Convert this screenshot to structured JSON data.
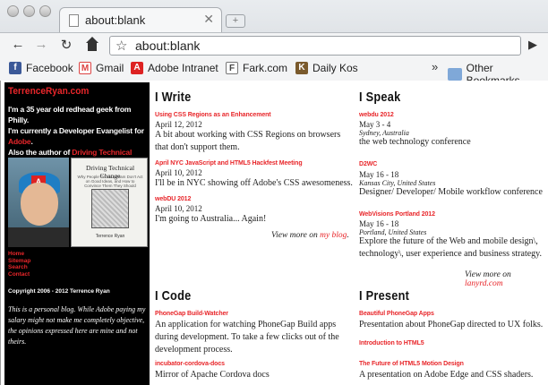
{
  "browser": {
    "tab_title": "about:blank",
    "url": "about:blank",
    "bookmarks": [
      {
        "label": "Facebook",
        "icon": "facebook-icon"
      },
      {
        "label": "Gmail",
        "icon": "gmail-icon"
      },
      {
        "label": "Adobe Intranet",
        "icon": "adobe-icon"
      },
      {
        "label": "Fark.com",
        "icon": "fark-icon"
      },
      {
        "label": "Daily Kos",
        "icon": "dailykos-icon"
      }
    ],
    "other_bookmarks": "Other Bookmarks"
  },
  "sidebar": {
    "site_title": "TerrenceRyan.com",
    "bio_line1": "I'm a 35 year old redhead geek from Philly.",
    "bio_line2a": "I'm currently a Developer Evangelist for ",
    "bio_employer": "Adobe",
    "bio_line2b": ".",
    "bio_line3a": "Also the author of ",
    "bio_book": "Driving Technical Change",
    "book_cover_title": "Driving Technical Change",
    "book_cover_sub": "Why People On Your Team Don't Act on Good Ideas, and How to Convince Them They Should",
    "book_cover_author": "Terrence Ryan",
    "nav": [
      "Home",
      "Sitemap",
      "Search",
      "Contact"
    ],
    "copyright": "Copyright 2006 - 2012 Terrence Ryan",
    "disclaimer": "This is a personal blog. While Adobe paying my salary might not make me completely objective, the opinions expressed here are mine and not theirs."
  },
  "write": {
    "title": "I Write",
    "entries": [
      {
        "title": "Using CSS Regions as an Enhancement",
        "date": "April 12, 2012",
        "text": "A bit about working with CSS Regions on browsers that don't support them."
      },
      {
        "title": "April NYC JavaScript and HTML5 Hackfest Meeting",
        "date": "April 10, 2012",
        "text": "I'll be in NYC showing off Adobe's CSS awesomeness."
      },
      {
        "title": "webDU 2012",
        "date": "April 10, 2012",
        "text": "I'm going to Australia... Again!"
      }
    ],
    "view_more_prefix": "View more on ",
    "view_more_link": "my blog",
    "view_more_suffix": "."
  },
  "speak": {
    "title": "I Speak",
    "entries": [
      {
        "title": "webdu 2012",
        "date": "May 3 - 4",
        "location": "Sydney, Australia",
        "text": "the web technology conference"
      },
      {
        "title": "D2WC",
        "date": "May 16 - 18",
        "location": "Kansas City, United States",
        "text": "Designer/ Developer/ Mobile workflow conference"
      },
      {
        "title": "WebVisions Portland 2012",
        "date": "May 16 - 18",
        "location": "Portland, United States",
        "text": "Explore the future of the Web and mobile design\\, technology\\, user experience and business strategy."
      }
    ],
    "view_more_prefix": "View more on ",
    "view_more_link": "lanyrd.com"
  },
  "code": {
    "title": "I Code",
    "entries": [
      {
        "title": "PhoneGap Build-Watcher",
        "text": "An application for watching PhoneGap Build apps during development. To take a few clicks out of the development process."
      },
      {
        "title": "incubator-cordova-docs",
        "text": "Mirror of Apache Cordova docs"
      }
    ]
  },
  "present": {
    "title": "I Present",
    "entries": [
      {
        "title": "Beautiful PhoneGap Apps",
        "text": "Presentation about PhoneGap directed to UX folks."
      },
      {
        "title": "Introduction to HTML5",
        "text": ""
      },
      {
        "title": "The Future of HTML5 Motion Design",
        "text": "A presentation on Adobe Edge and CSS shaders."
      }
    ]
  },
  "colors": {
    "accent": "#e8262a",
    "sidebar_bg": "#000000"
  }
}
